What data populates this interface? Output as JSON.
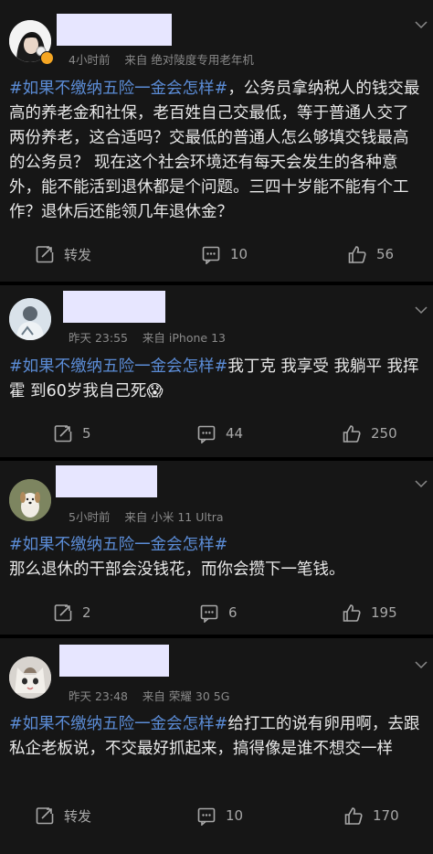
{
  "posts": [
    {
      "time": "4小时前",
      "source_prefix": "来自",
      "source": "绝对陵度专用老年机",
      "hashtag": "#如果不缴纳五险一金会怎样#",
      "text": "，公务员拿纳税人的钱交最高的养老金和社保，老百姓自己交最低，等于普通人交了两份养老，这合适吗？交最低的普通人怎么够填交钱最高的公务员？ 现在这个社会环境还有每天会发生的各种意外，能不能活到退休都是个问题。三四十岁能不能有个工作？退休后还能领几年退休金？",
      "repost_label": "转发",
      "comments": "10",
      "likes": "56"
    },
    {
      "time": "昨天 23:55",
      "source_prefix": "来自",
      "source": "iPhone 13",
      "hashtag": "#如果不缴纳五险一金会怎样#",
      "text": "我丁克 我享受 我躺平 我挥霍 到60岁我自己死😱",
      "repost_label": "5",
      "comments": "44",
      "likes": "250"
    },
    {
      "time": "5小时前",
      "source_prefix": "来自",
      "source": "小米 11 Ultra",
      "hashtag": "#如果不缴纳五险一金会怎样#",
      "text": "\n那么退休的干部会没钱花，而你会攒下一笔钱。",
      "repost_label": "2",
      "comments": "6",
      "likes": "195"
    },
    {
      "time": "昨天 23:48",
      "source_prefix": "来自",
      "source": "荣耀 30 5G",
      "hashtag": "#如果不缴纳五险一金会怎样#",
      "text": "给打工的说有卵用啊，去跟私企老板说，不交最好抓起来，搞得像是谁不想交一样",
      "repost_label": "转发",
      "comments": "10",
      "likes": "170"
    }
  ]
}
